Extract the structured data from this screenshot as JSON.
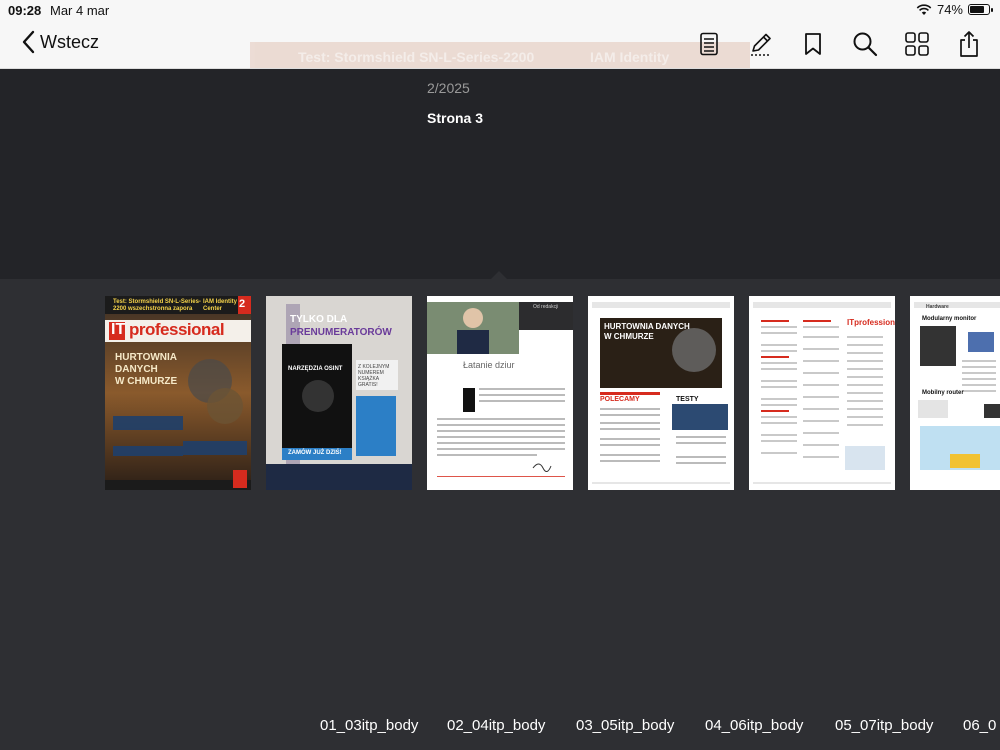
{
  "status": {
    "time": "09:28",
    "date": "Mar 4 mar",
    "battery": "74%"
  },
  "nav": {
    "back_label": "Wstecz",
    "banner_left": "Test: Stormshield SN-L-Series-2200",
    "banner_right": "IAM Identity",
    "icons": [
      "list-icon",
      "pencil-icon",
      "bookmark-icon",
      "search-icon",
      "grid-icon",
      "share-icon"
    ]
  },
  "issue": {
    "number": "2/2025",
    "page": "Strona 3"
  },
  "cover": {
    "banner": "Test: Stormshield SN-L-Series-2200 wszechstronna zapora",
    "banner_right": "IAM Identity Center",
    "number": "2",
    "logo_it": "IT",
    "logo_rest": "professional",
    "headline1": "HURTOWNIA",
    "headline2": "DANYCH",
    "headline3": "W CHMURZE"
  },
  "ad": {
    "title1": "TYLKO DLA",
    "title2": "PRENUMERATORÓW",
    "book_title": "NARZĘDZIA OSINT",
    "badge": "Z KOLEJNYM NUMEREM KSIĄŻKA GRATIS!",
    "footer": "ZAMÓW JUŻ DZIŚ!"
  },
  "editorial": {
    "heading": "Łatanie dziur",
    "tag": "Od redakcji"
  },
  "toc1": {
    "title1": "HURTOWNIA DANYCH",
    "title2": "W CHMURZE",
    "section1": "POLECAMY",
    "section2": "TESTY"
  },
  "toc2": {
    "logo_it": "IT",
    "logo_rest": "professional"
  },
  "page7": {
    "section": "Hardware",
    "heading": "Modularny monitor",
    "subheading": "Mobilny router"
  },
  "thumb_labels": [
    "01_03itp_body",
    "02_04itp_body",
    "03_05itp_body",
    "04_06itp_body",
    "05_07itp_body",
    "06_0"
  ]
}
